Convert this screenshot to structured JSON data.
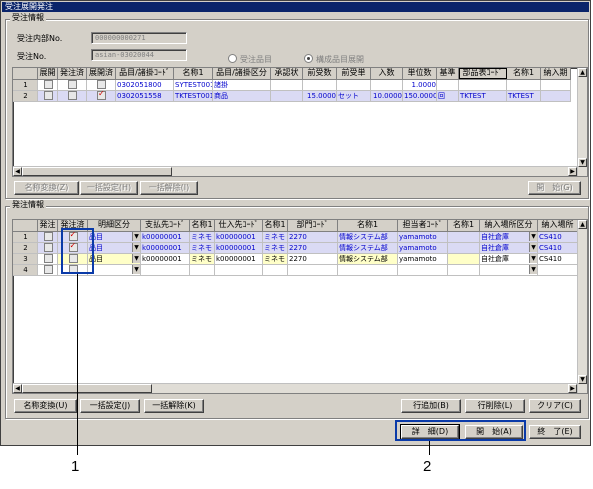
{
  "window": {
    "title": "受注展開発注"
  },
  "order_info": {
    "group_title": "受注情報",
    "internal_no_label": "受注内部No.",
    "internal_no_value": "000000000271",
    "order_no_label": "受注No.",
    "order_no_value": "asian-03020044",
    "radio_item": "受注品目",
    "radio_component": "構成品目展開",
    "radio_selected": "構成品目展開"
  },
  "order_grid": {
    "headers": [
      "",
      "展開",
      "発注済",
      "展開済",
      "品目/諸掛ｺｰﾄﾞ",
      "名称1",
      "品目/諸掛区分",
      "承認状",
      "前受数",
      "前受単",
      "入数",
      "単位数",
      "基準",
      "部品表ｺｰﾄﾞ",
      "名称1",
      "納入期"
    ],
    "rows": [
      {
        "no": "1",
        "expand": false,
        "ordered": false,
        "expanded": false,
        "code": "0302051800",
        "name": "SYTEST001",
        "category": "諸掛",
        "approval": "",
        "qty": "",
        "unit": "",
        "pack": "",
        "unit_qty": "1.0000",
        "std": "",
        "bom_code": "",
        "bom_name": "",
        "delivery": ""
      },
      {
        "no": "2",
        "expand": false,
        "ordered": false,
        "expanded": true,
        "code": "0302051558",
        "name": "TKTEST001",
        "category": "商品",
        "approval": "",
        "qty": "15.0000",
        "unit": "セット",
        "pack": "10.0000",
        "unit_qty": "150.0000",
        "std": "回",
        "bom_code": "TKTEST",
        "bom_name": "TKTEST",
        "delivery": ""
      }
    ],
    "buttons": {
      "name_convert": "名称変換(Z)",
      "bulk_set": "一括設定(H)",
      "bulk_clear": "一括解除(I)",
      "open": "開　始(G)"
    }
  },
  "purchase_info": {
    "group_title": "発注情報",
    "headers": [
      "",
      "発注",
      "発注済",
      "明細区分",
      "支払先ｺｰﾄﾞ",
      "名称1",
      "仕入先ｺｰﾄﾞ",
      "名称1",
      "部門ｺｰﾄﾞ",
      "名称1",
      "担当者ｺｰﾄﾞ",
      "名称1",
      "納入場所区分",
      "納入場所"
    ],
    "rows": [
      {
        "no": "1",
        "order": false,
        "ordered": true,
        "detail": "品目",
        "payee_code": "k00000001",
        "payee_name": "ミネモ",
        "supplier_code": "k00000001",
        "supplier_name": "ミネモ",
        "dept_code": "2270",
        "dept_name": "情報システム部",
        "staff_code": "yamamoto",
        "staff_name": "",
        "place_type": "自社倉庫",
        "place": "CS410"
      },
      {
        "no": "2",
        "order": false,
        "ordered": true,
        "detail": "品目",
        "payee_code": "k00000001",
        "payee_name": "ミネモ",
        "supplier_code": "k00000001",
        "supplier_name": "ミネモ",
        "dept_code": "2270",
        "dept_name": "情報システム部",
        "staff_code": "yamamoto",
        "staff_name": "",
        "place_type": "自社倉庫",
        "place": "CS410"
      },
      {
        "no": "3",
        "order": false,
        "ordered": false,
        "detail": "品目",
        "payee_code": "k00000001",
        "payee_name": "ミネモ",
        "supplier_code": "k00000001",
        "supplier_name": "ミネモ",
        "dept_code": "2270",
        "dept_name": "情報システム部",
        "staff_code": "yamamoto",
        "staff_name": "",
        "place_type": "自社倉庫",
        "place": "CS410"
      },
      {
        "no": "4",
        "order": false,
        "ordered": false,
        "detail": "",
        "payee_code": "",
        "payee_name": "",
        "supplier_code": "",
        "supplier_name": "",
        "dept_code": "",
        "dept_name": "",
        "staff_code": "",
        "staff_name": "",
        "place_type": "",
        "place": ""
      }
    ],
    "buttons": {
      "name_convert": "名称変換(U)",
      "bulk_set": "一括設定(J)",
      "bulk_clear": "一括解除(K)",
      "row_add": "行追加(B)",
      "row_delete": "行削除(L)",
      "clear": "クリア(C)"
    }
  },
  "footer": {
    "detail": "詳　細(D)",
    "open": "開　始(A)",
    "close": "終　了(E)"
  },
  "callouts": {
    "one": "1",
    "two": "2"
  },
  "colors": {
    "highlight": "#0a3aa8",
    "selected_row": "#dadaf4",
    "link_text": "#0000cc"
  }
}
